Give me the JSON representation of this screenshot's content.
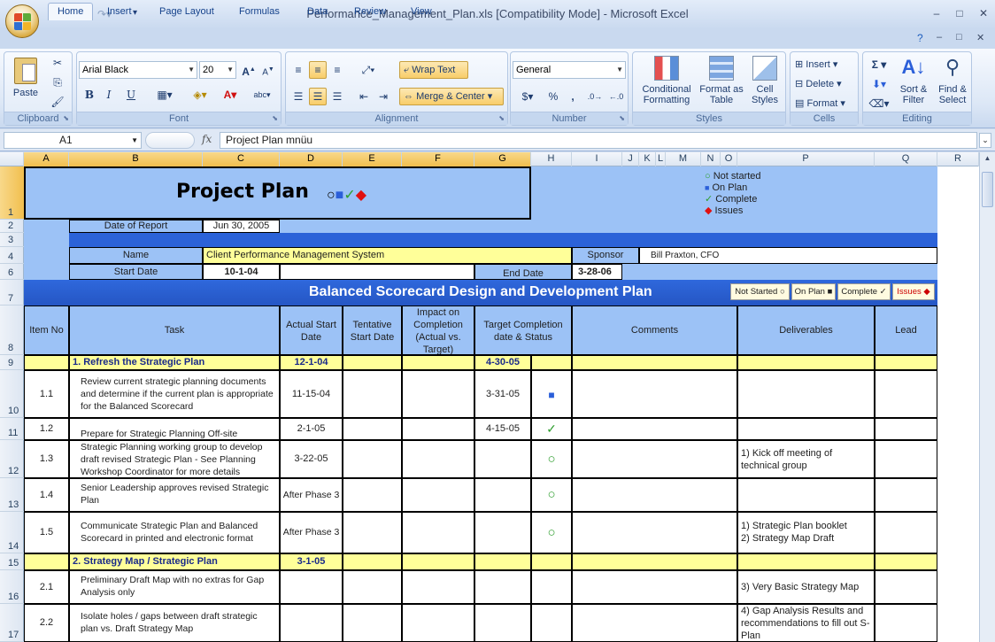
{
  "window": {
    "title": "Performance_Management_Plan.xls  [Compatibility Mode] - Microsoft Excel",
    "controls": [
      "–",
      "□",
      "✕"
    ],
    "doc_controls": [
      "?",
      "–",
      "□",
      "✕"
    ]
  },
  "ribbon_tabs": [
    "Home",
    "Insert",
    "Page Layout",
    "Formulas",
    "Data",
    "Review",
    "View"
  ],
  "clipboard": {
    "label": "Clipboard",
    "paste": "Paste"
  },
  "font": {
    "label": "Font",
    "name": "Arial Black",
    "size": "20",
    "bold": "B",
    "italic": "I",
    "underline": "U"
  },
  "alignment": {
    "label": "Alignment",
    "wrap": "Wrap Text",
    "merge": "Merge & Center"
  },
  "number": {
    "label": "Number",
    "format": "General",
    "percent": "%",
    "comma": ","
  },
  "styles": {
    "label": "Styles",
    "conditional": "Conditional Formatting",
    "format_table": "Format as Table",
    "cell_styles": "Cell Styles"
  },
  "cells": {
    "label": "Cells",
    "insert": "Insert",
    "delete": "Delete",
    "format": "Format"
  },
  "editing": {
    "label": "Editing",
    "sort": "Sort & Filter",
    "find": "Find & Select",
    "sigma": "Σ"
  },
  "formula_bar": {
    "name_box": "A1",
    "fx": "fx",
    "content": "Project Plan  mnüu"
  },
  "columns": [
    "A",
    "B",
    "C",
    "D",
    "E",
    "F",
    "G",
    "H",
    "I",
    "J",
    "K",
    "L",
    "M",
    "N",
    "O",
    "P",
    "Q",
    "R"
  ],
  "rows": [
    "1",
    "2",
    "3",
    "4",
    "6",
    "7",
    "8",
    "9",
    "10",
    "11",
    "12",
    "13",
    "14",
    "15",
    "16",
    "17"
  ],
  "sheet": {
    "title": "Project Plan",
    "title_symbols": "○■✓◆",
    "legend": [
      {
        "sym": "○",
        "label": "Not started",
        "color": "#2e9e2e"
      },
      {
        "sym": "■",
        "label": "On Plan",
        "color": "#2b5fd9"
      },
      {
        "sym": "✓",
        "label": "Complete",
        "color": "#2e9e2e"
      },
      {
        "sym": "◆",
        "label": "Issues",
        "color": "#e01010"
      }
    ],
    "date_of_report_label": "Date of Report",
    "date_of_report": "Jun 30, 2005",
    "name_label": "Name",
    "name": "Client Performance Management System",
    "sponsor_label": "Sponsor",
    "sponsor": "Bill Praxton, CFO",
    "start_date_label": "Start Date",
    "start_date": "10-1-04",
    "end_date_label": "End Date",
    "end_date": "3-28-06",
    "banner": "Balanced Scorecard Design and Development Plan",
    "status_buttons": [
      {
        "label": "Not Started ○",
        "color": "#000"
      },
      {
        "label": "On Plan ■",
        "color": "#000"
      },
      {
        "label": "Complete ✓",
        "color": "#000"
      },
      {
        "label": "Issues ◆",
        "color": "#cc0000"
      }
    ],
    "headers": {
      "item": "Item No",
      "task": "Task",
      "actual": "Actual Start Date",
      "tentative": "Tentative Start Date",
      "impact": "Impact on Completion (Actual vs. Target)",
      "target": "Target Completion date & Status",
      "comments": "Comments",
      "deliverables": "Deliverables",
      "lead": "Lead"
    },
    "rows": [
      {
        "kind": "section",
        "task": "1. Refresh the Strategic Plan",
        "actual": "12-1-04",
        "target": "4-30-05"
      },
      {
        "item": "1.1",
        "task": "Review current strategic planning documents and determine if the current plan is appropriate for the Balanced Scorecard",
        "actual": "11-15-04",
        "target": "3-31-05",
        "status": "■",
        "status_color": "#2b5fd9",
        "deliv": ""
      },
      {
        "item": "1.2",
        "task": "Prepare for Strategic Planning Off-site",
        "actual": "2-1-05",
        "target": "4-15-05",
        "status": "✓",
        "status_color": "#2e9e2e",
        "deliv": ""
      },
      {
        "item": "1.3",
        "task": "Strategic Planning working group to develop draft revised Strategic Plan - See Planning Workshop Coordinator for more details",
        "actual": "3-22-05",
        "target": "",
        "status": "○",
        "status_color": "#2e9e2e",
        "deliv": "1) Kick off meeting of technical group"
      },
      {
        "item": "1.4",
        "task": "Senior Leadership approves revised Strategic Plan",
        "actual": "After Phase 3",
        "target": "",
        "status": "○",
        "status_color": "#2e9e2e",
        "deliv": ""
      },
      {
        "item": "1.5",
        "task": "Communicate Strategic Plan and Balanced Scorecard in printed and electronic format",
        "actual": "After Phase 3",
        "target": "",
        "status": "○",
        "status_color": "#2e9e2e",
        "deliv": "1) Strategic Plan booklet\n2) Strategy Map Draft"
      },
      {
        "kind": "section",
        "task": "2. Strategy Map / Strategic Plan",
        "actual": "3-1-05",
        "target": ""
      },
      {
        "item": "2.1",
        "task": "Preliminary Draft Map with no extras for Gap Analysis only",
        "actual": "",
        "target": "",
        "status": "",
        "status_color": "#000",
        "deliv": "3) Very Basic Strategy Map"
      },
      {
        "item": "2.2",
        "task": "Isolate holes / gaps between draft strategic plan vs. Draft Strategy Map",
        "actual": "",
        "target": "",
        "status": "",
        "status_color": "#000",
        "deliv": "4) Gap Analysis Results and recommendations to fill out S-Plan"
      }
    ]
  }
}
